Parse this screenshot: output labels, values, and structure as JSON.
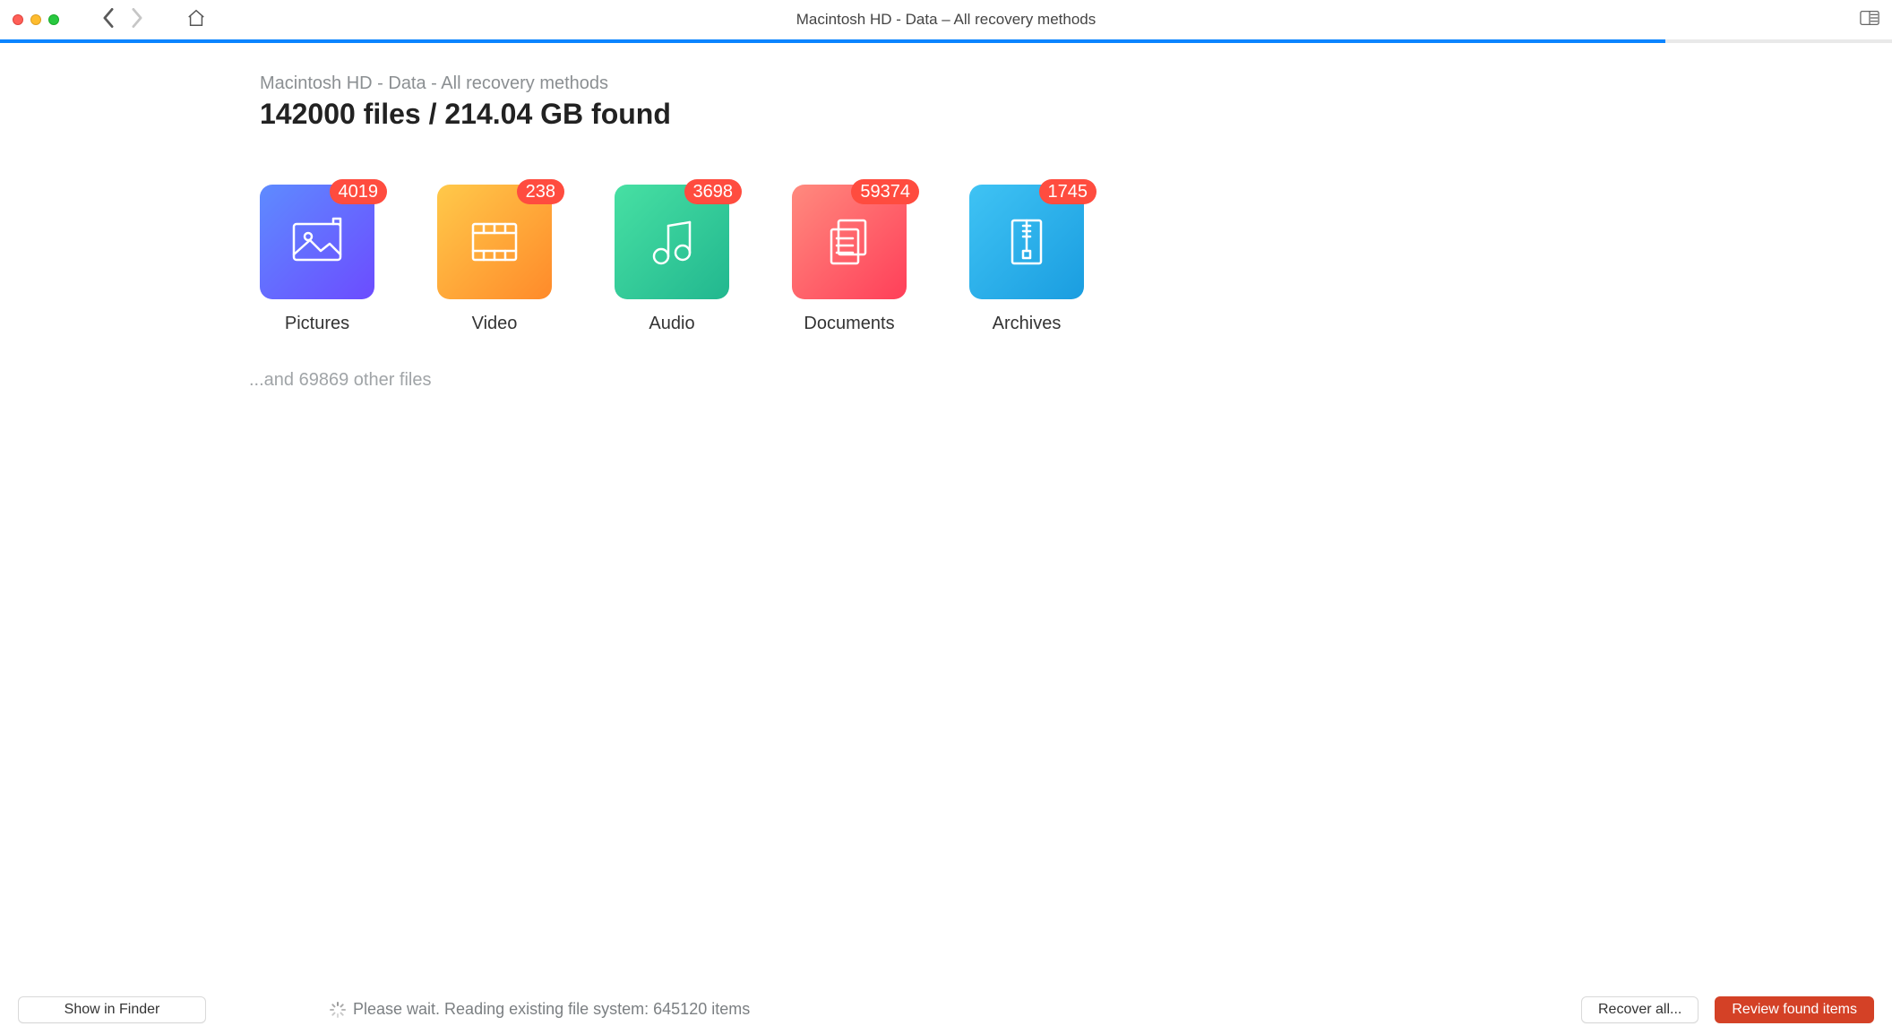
{
  "window_title": "Macintosh HD - Data – All recovery methods",
  "progress_percent": 88,
  "breadcrumb": "Macintosh HD - Data - All recovery methods",
  "headline": "142000 files / 214.04 GB found",
  "categories": [
    {
      "id": "pictures",
      "label": "Pictures",
      "count": "4019",
      "gradient": "grad-pic",
      "icon": "image-icon"
    },
    {
      "id": "video",
      "label": "Video",
      "count": "238",
      "gradient": "grad-vid",
      "icon": "video-icon"
    },
    {
      "id": "audio",
      "label": "Audio",
      "count": "3698",
      "gradient": "grad-aud",
      "icon": "audio-icon"
    },
    {
      "id": "documents",
      "label": "Documents",
      "count": "59374",
      "gradient": "grad-doc",
      "icon": "document-icon"
    },
    {
      "id": "archives",
      "label": "Archives",
      "count": "1745",
      "gradient": "grad-arc",
      "icon": "archive-icon"
    }
  ],
  "other_files_line": "...and 69869 other files",
  "status_text": "Please wait. Reading existing file system: 645120 items",
  "footer": {
    "show_in_finder": "Show in Finder",
    "recover_all": "Recover all...",
    "review": "Review found items"
  }
}
